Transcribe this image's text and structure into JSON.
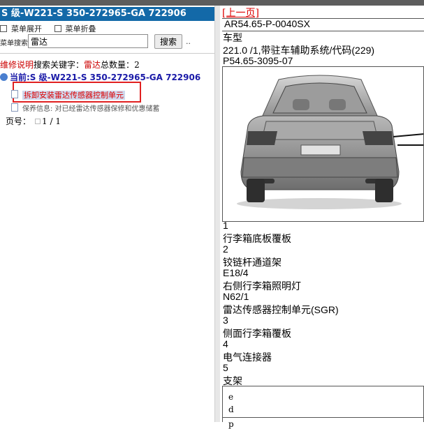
{
  "left": {
    "title": "S 级-W221-S 350-272965-GA 722906",
    "toolbar": {
      "expand": "菜单展开",
      "collapse": "菜单折叠"
    },
    "search": {
      "label": "菜单搜索",
      "value": "雷达",
      "button": "搜索",
      "more": ".."
    },
    "result": {
      "prefix": "维修说明",
      "mid": "搜索关键字：",
      "keyword": "雷达",
      "count_label": "总数量：",
      "count": "2"
    },
    "tree": {
      "root": "当前:S 级-W221-S 350-272965-GA 722906",
      "items": [
        {
          "label": "拆卸安装雷达传感器控制单元"
        },
        {
          "label": "保养信息: 对已经雷达传感器保修和优惠储蓄"
        }
      ]
    },
    "pager": {
      "label": "页号：",
      "value": "1 / 1"
    }
  },
  "right": {
    "prev": "[上一页]",
    "doc_id": "AR54.65-P-0040SX",
    "model_label": "车型",
    "model_value": "221.0 /1,带驻车辅助系统/代码(229)",
    "figure_id": "P54.65-3095-07",
    "legend": [
      {
        "num": "1",
        "text": "行李箱底板覆板"
      },
      {
        "num": "2",
        "text": "铰链杆通道架"
      },
      {
        "num": "E18/4",
        "text": "右侧行李箱照明灯"
      },
      {
        "num": "N62/1",
        "text": "雷达传感器控制单元(SGR)"
      },
      {
        "num": "3",
        "text": "侧面行李箱覆板"
      },
      {
        "num": "4",
        "text": "电气连接器"
      },
      {
        "num": "5",
        "text": "支架"
      }
    ],
    "table_rows": [
      "e",
      "d",
      "p"
    ]
  },
  "colors": {
    "title_bg": "#1369a8",
    "link_red": "#d00",
    "highlight": "#e02020"
  }
}
